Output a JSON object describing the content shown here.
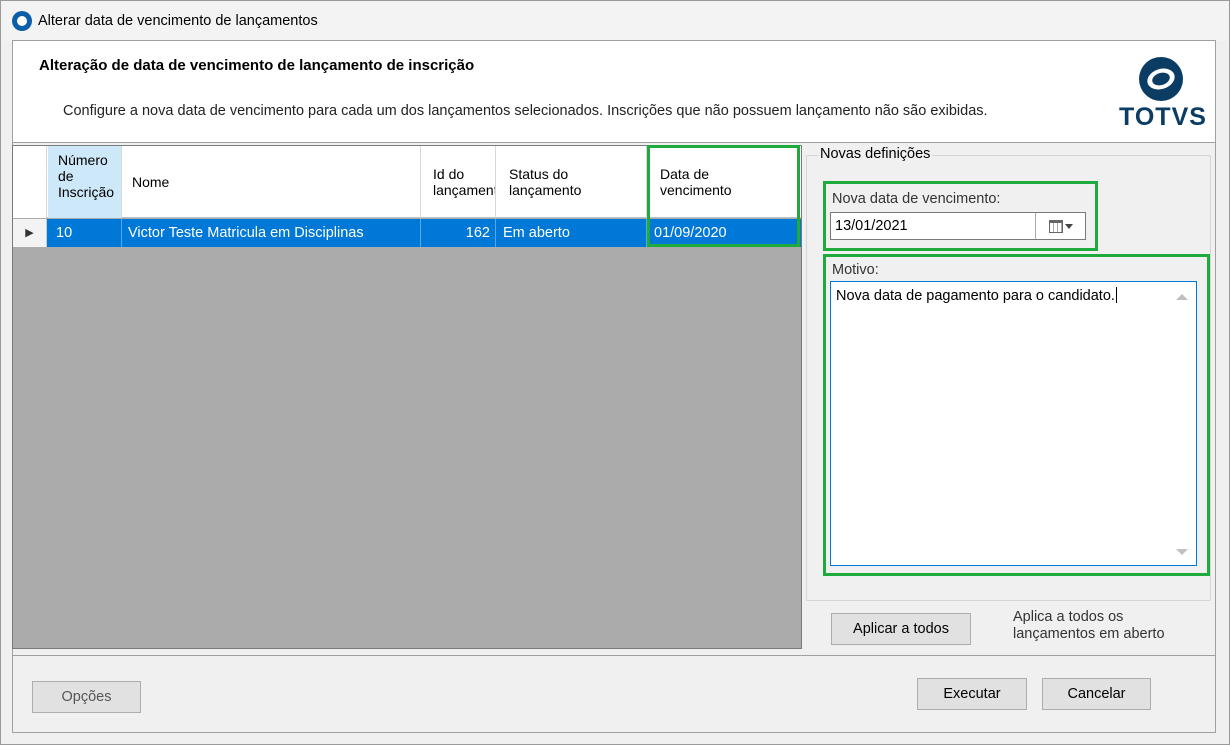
{
  "window": {
    "title": "Alterar data de vencimento de lançamentos"
  },
  "header": {
    "title": "Alteração de data de vencimento de lançamento de inscrição",
    "description": "Configure a nova data de vencimento para cada um dos lançamentos selecionados. Inscrições que não possuem lançamento não são exibidas.",
    "logo_text": "TOTVS"
  },
  "grid": {
    "columns": {
      "numero": "Número\nde\nInscrição",
      "nome": "Nome",
      "id": "Id do\nlançamento",
      "status": "Status do\nlançamento",
      "data": "Data de\nvencimento"
    },
    "rows": [
      {
        "numero": "10",
        "nome": "Victor Teste Matricula em Disciplinas",
        "id": "162",
        "status": "Em aberto",
        "data": "01/09/2020"
      }
    ]
  },
  "novas_definicoes": {
    "legend": "Novas definições",
    "date_label": "Nova data de vencimento:",
    "date_value": "13/01/2021",
    "motivo_label": "Motivo:",
    "motivo_value": "Nova data de pagamento para o candidato."
  },
  "actions": {
    "aplicar_label": "Aplicar a todos",
    "aplicar_note": "Aplica a todos os\nlançamentos em aberto",
    "opcoes_label": "Opções",
    "executar_label": "Executar",
    "cancelar_label": "Cancelar"
  },
  "colors": {
    "selection": "#0078d7",
    "highlight": "#1eaa3c",
    "brand": "#0b3c64"
  },
  "icons": [
    "app-icon",
    "totvs-logo-icon",
    "row-pointer-icon",
    "calendar-icon",
    "dropdown-arrow-icon",
    "scroll-up-icon",
    "scroll-down-icon"
  ]
}
